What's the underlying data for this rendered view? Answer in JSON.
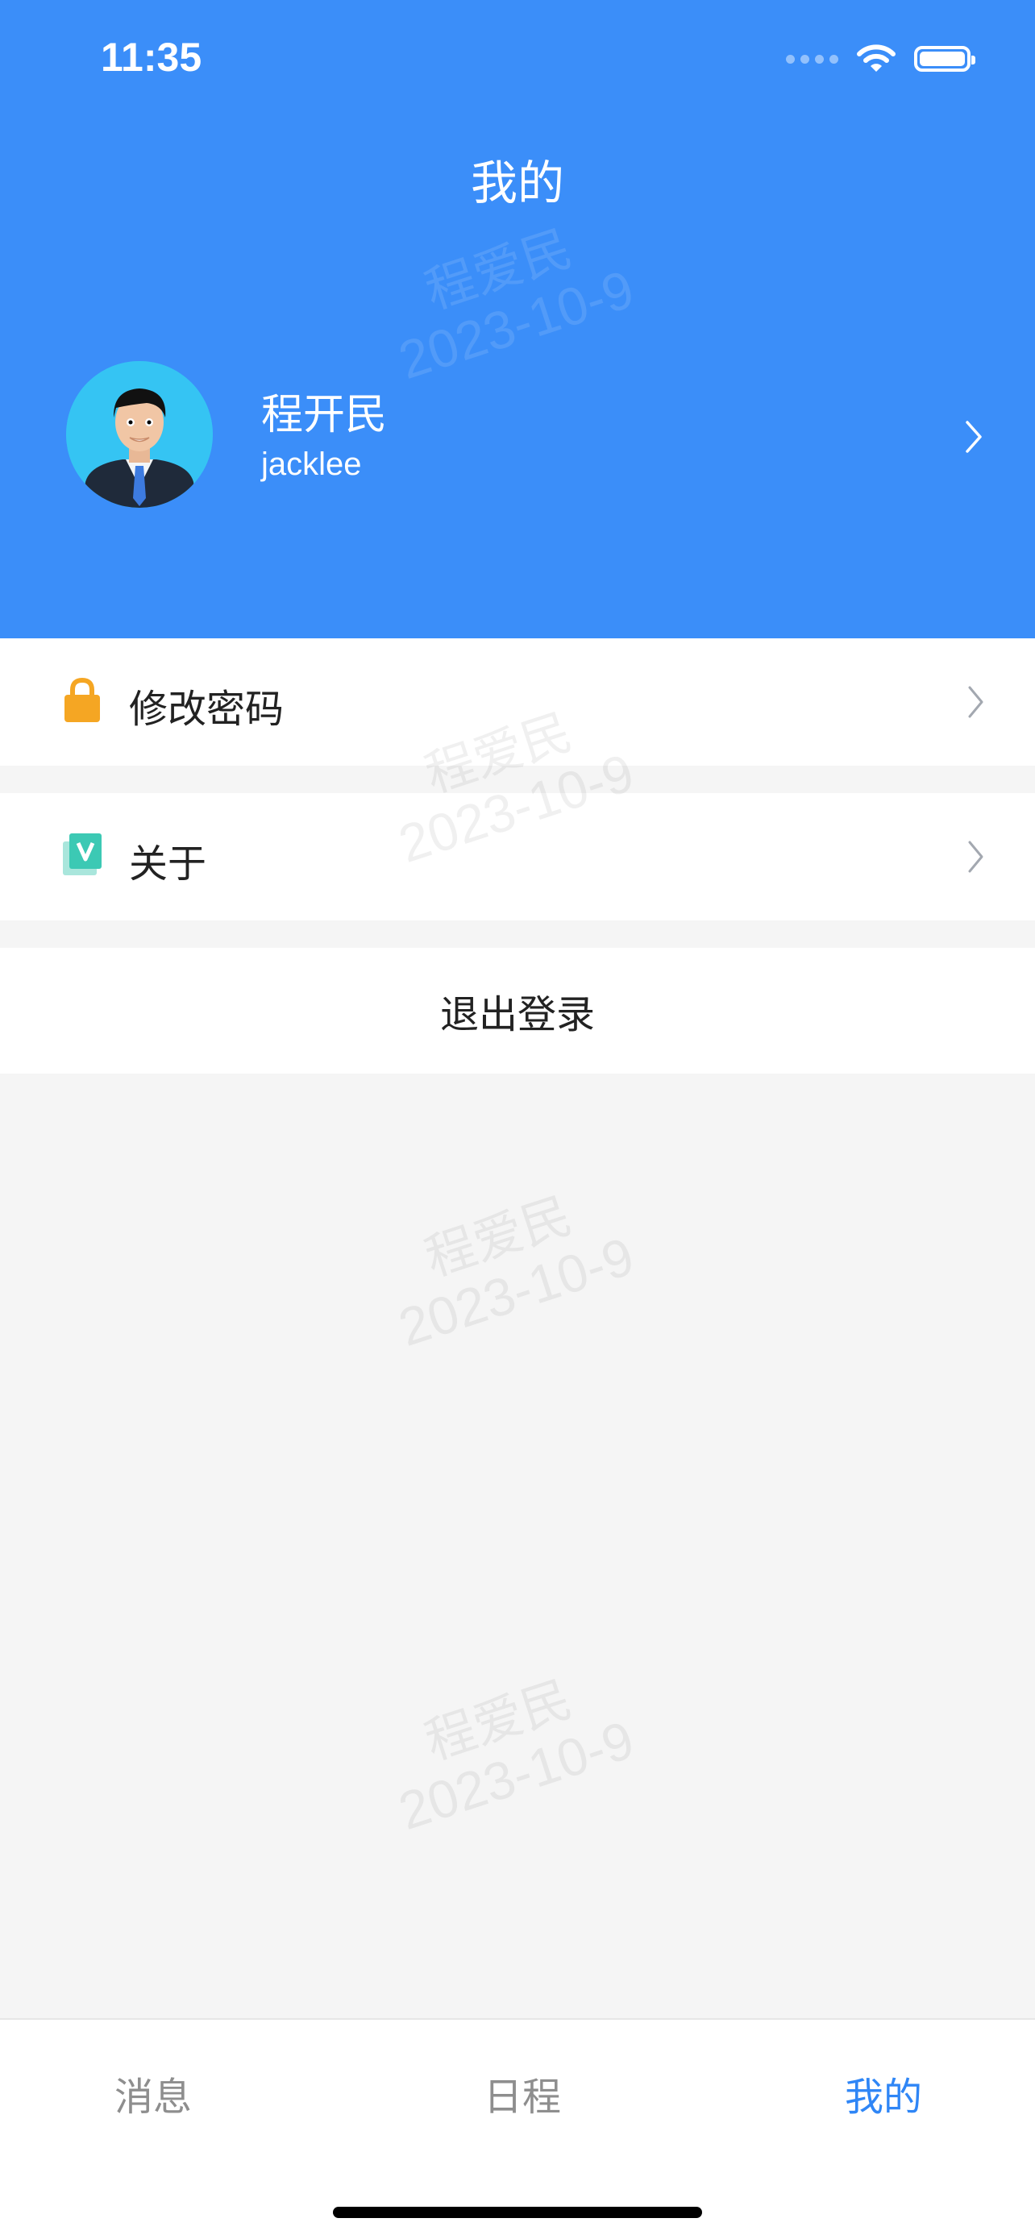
{
  "status_bar": {
    "time": "11:35"
  },
  "header": {
    "title": "我的",
    "profile": {
      "name": "程开民",
      "username": "jacklee"
    }
  },
  "menu": {
    "change_password": "修改密码",
    "about": "关于",
    "logout": "退出登录"
  },
  "watermark": {
    "name": "程爱民",
    "date": "2023-10-9"
  },
  "tabbar": {
    "tabs": [
      {
        "label": "消息",
        "active": false
      },
      {
        "label": "日程",
        "active": false
      },
      {
        "label": "我的",
        "active": true
      }
    ]
  },
  "colors": {
    "header_bg": "#3b8ef9",
    "active_tab": "#2f86f6",
    "lock_icon": "#f5a623",
    "about_icon": "#3cc9b4"
  },
  "icons": [
    "wifi-icon",
    "battery-icon",
    "lock-icon",
    "about-icon",
    "chevron-right-icon"
  ]
}
